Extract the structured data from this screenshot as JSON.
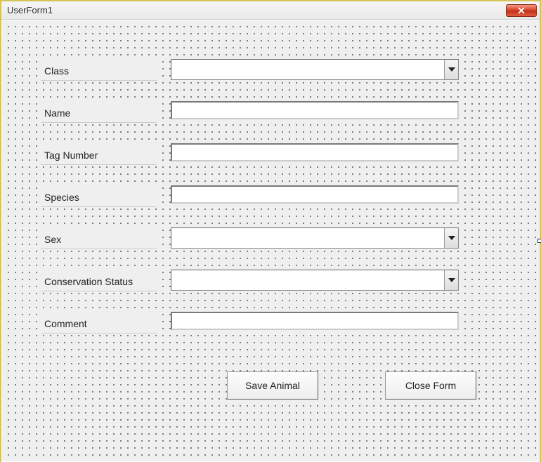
{
  "window": {
    "title": "UserForm1"
  },
  "labels": {
    "class": "Class",
    "name": "Name",
    "tagNumber": "Tag Number",
    "species": "Species",
    "sex": "Sex",
    "conservation": "Conservation Status",
    "comment": "Comment"
  },
  "fields": {
    "class": "",
    "name": "",
    "tagNumber": "",
    "species": "",
    "sex": "",
    "conservation": "",
    "comment": ""
  },
  "buttons": {
    "save": "Save Animal",
    "close": "Close Form"
  }
}
